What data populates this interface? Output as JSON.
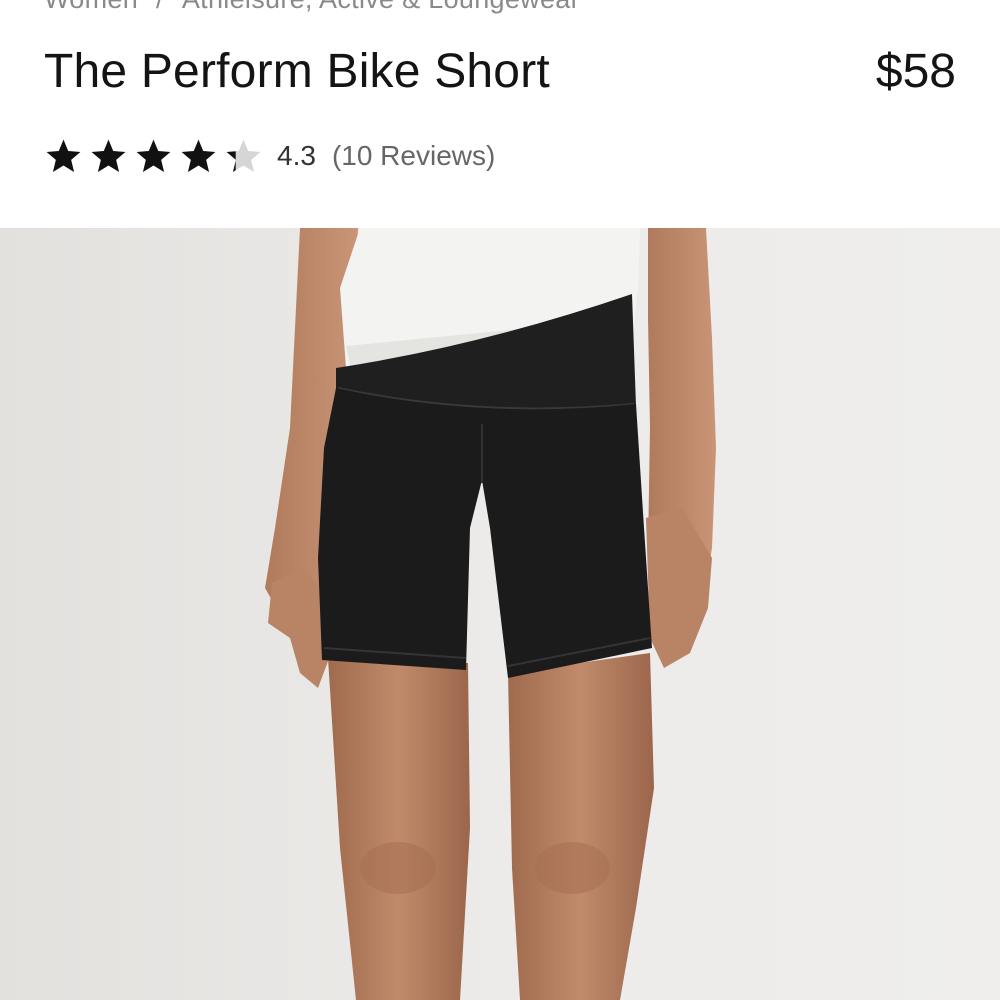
{
  "breadcrumb": {
    "items": [
      "Women",
      "Athleisure, Active & Loungewear"
    ],
    "separator": "/"
  },
  "product": {
    "title": "The Perform Bike Short",
    "price": "$58",
    "rating": {
      "value": "4.3",
      "stars": 4.3,
      "max_stars": 5,
      "reviews_label": "(10 Reviews)"
    }
  },
  "image": {
    "subject": "model-wearing-black-bike-shorts",
    "colors": {
      "background": "#eceae8",
      "shorts": "#1b1a1a",
      "shirt": "#f2f2f0",
      "skin": "#b98365"
    }
  },
  "colors": {
    "star": "#111111",
    "star_empty": "#d6d6d6",
    "breadcrumb": "#8a8a8a"
  }
}
